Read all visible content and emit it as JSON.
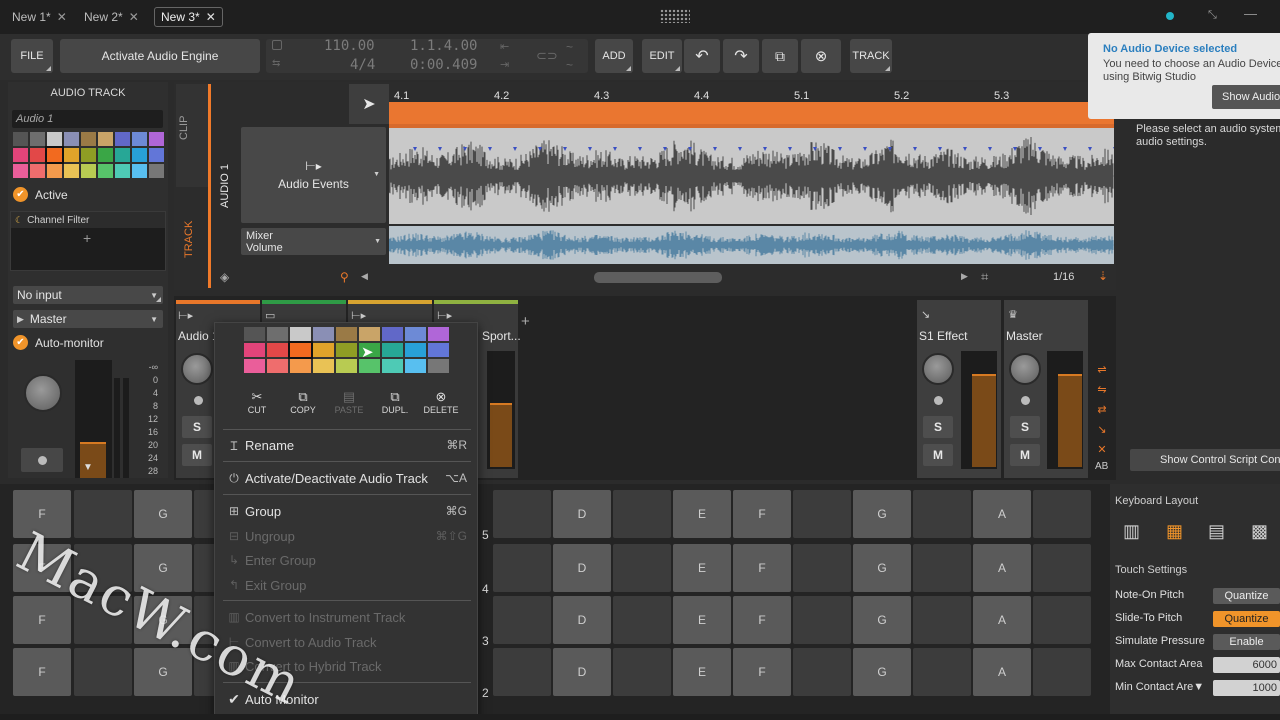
{
  "tabs": [
    {
      "label": "New 1*"
    },
    {
      "label": "New 2*"
    },
    {
      "label": "New 3*"
    }
  ],
  "toolbar": {
    "file": "FILE",
    "activate_audio_engine": "Activate Audio Engine",
    "tempo": "110.00",
    "time_signature": "4/4",
    "position_bars": "1.1.4.00",
    "position_time": "0:00.409",
    "add": "ADD",
    "edit": "EDIT",
    "track": "TRACK"
  },
  "notification": {
    "title": "No Audio Device selected",
    "body_line1": "You need to choose an Audio Device",
    "body_line2": "using Bitwig Studio",
    "button": "Show Audio",
    "note_line1": "Please select an audio system",
    "note_line2": "audio settings."
  },
  "inspector": {
    "header": "AUDIO TRACK",
    "track_name": "Audio 1",
    "active_label": "Active",
    "channel_filter": "Channel Filter",
    "input": "No input",
    "output": "Master",
    "auto_monitor": "Auto-monitor",
    "meter_scale": [
      "-∞",
      "0",
      "4",
      "8",
      "12",
      "16",
      "20",
      "24",
      "28"
    ]
  },
  "arranger": {
    "clip_label": "CLIP",
    "track_label": "TRACK",
    "track_name": "AUDIO 1",
    "audio_events": "Audio Events",
    "mixer_line1": "Mixer",
    "mixer_line2": "Volume",
    "ruler": [
      "4.1",
      "4.2",
      "4.3",
      "4.4",
      "5.1",
      "5.2",
      "5.3"
    ],
    "zoom": "1/16"
  },
  "mixer": {
    "track1": "Audio 1",
    "track4": "l Sport...",
    "effect": "S1 Effect",
    "master": "Master",
    "solo": "S",
    "mute": "M",
    "ab": "AB"
  },
  "context_menu": {
    "actions": [
      "CUT",
      "COPY",
      "PASTE",
      "DUPL.",
      "DELETE"
    ],
    "items": [
      {
        "label": "Rename",
        "shortcut": "⌘R"
      },
      {
        "label": "Activate/Deactivate Audio Track",
        "shortcut": "⌥A"
      },
      {
        "label": "Group",
        "shortcut": "⌘G"
      },
      {
        "label": "Ungroup",
        "shortcut": "⌘⇧G"
      },
      {
        "label": "Enter Group",
        "shortcut": ""
      },
      {
        "label": "Exit Group",
        "shortcut": ""
      },
      {
        "label": "Convert to Instrument Track",
        "shortcut": ""
      },
      {
        "label": "Convert to Audio Track",
        "shortcut": ""
      },
      {
        "label": "Convert to Hybrid Track",
        "shortcut": ""
      },
      {
        "label": "Auto Monitor",
        "shortcut": ""
      }
    ]
  },
  "keyboard": {
    "octave_labels": [
      "5",
      "4",
      "3",
      "2"
    ],
    "left_notes": [
      "F",
      "G"
    ],
    "right_notes": [
      "D",
      "E",
      "F",
      "G",
      "A"
    ]
  },
  "right_panel": {
    "show_control_script": "Show Control Script Con",
    "keyboard_layout": "Keyboard Layout",
    "touch_settings": "Touch Settings",
    "settings": [
      {
        "label": "Note-On Pitch",
        "value": "Quantize"
      },
      {
        "label": "Slide-To Pitch",
        "value": "Quantize"
      },
      {
        "label": "Simulate Pressure",
        "value": "Enable"
      },
      {
        "label": "Max Contact Area",
        "value": "6000"
      },
      {
        "label": "Min Contact Are▼",
        "value": "1000"
      }
    ]
  },
  "watermark": "MacW.com",
  "colors": {
    "accent_orange": "#f07a2a",
    "selected_orange": "#ff8f1f",
    "notification_title": "#2b7fbf"
  }
}
